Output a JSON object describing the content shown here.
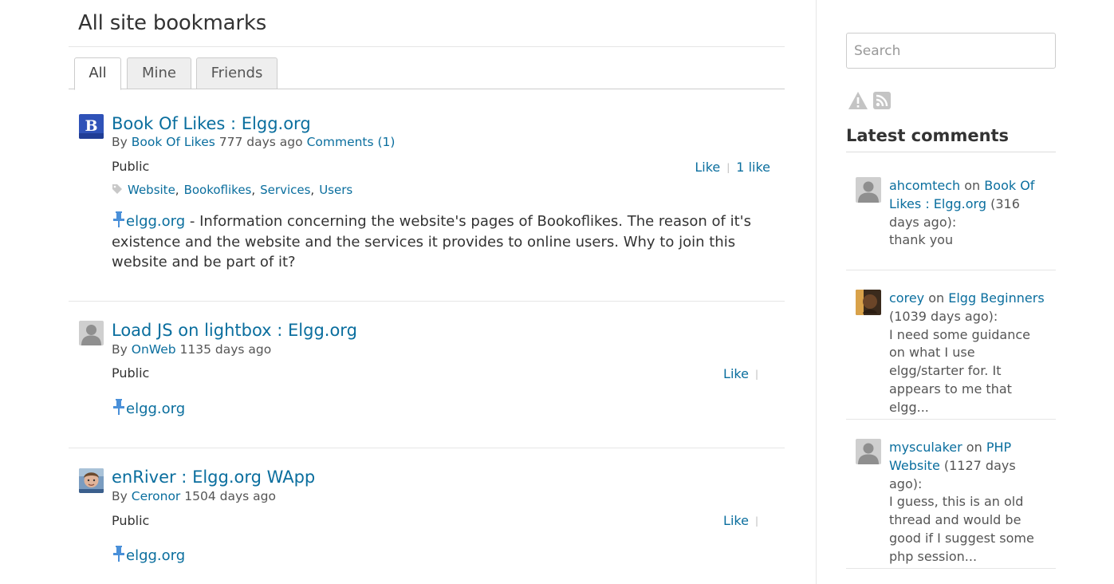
{
  "page": {
    "title": "All site bookmarks"
  },
  "tabs": [
    {
      "label": "All",
      "active": true
    },
    {
      "label": "Mine",
      "active": false
    },
    {
      "label": "Friends",
      "active": false
    }
  ],
  "bookmarks": [
    {
      "title": "Book Of Likes : Elgg.org",
      "by": "By",
      "author": "Book Of Likes",
      "age": "777 days ago",
      "comments_link": "Comments (1)",
      "access": "Public",
      "like_label": "Like",
      "like_count": "1 like",
      "tags": [
        "Website",
        "Bookoflikes",
        "Services",
        "Users"
      ],
      "link": "elgg.org",
      "description": " - Information concerning the website's pages of Bookoflikes. The reason of it's existence and the website and the services it provides to online users. Why to join this website and be part of it?"
    },
    {
      "title": "Load JS on lightbox : Elgg.org",
      "by": "By",
      "author": "OnWeb",
      "age": "1135 days ago",
      "access": "Public",
      "like_label": "Like",
      "link": "elgg.org"
    },
    {
      "title": "enRiver : Elgg.org WApp",
      "by": "By",
      "author": "Ceronor",
      "age": "1504 days ago",
      "access": "Public",
      "like_label": "Like",
      "link": "elgg.org"
    }
  ],
  "sidebar": {
    "search_placeholder": "Search",
    "latest_comments_heading": "Latest comments",
    "comments": [
      {
        "user": "ahcomtech",
        "on": "on",
        "target": "Book Of Likes : Elgg.org",
        "age": "(316 days ago):",
        "text": "thank you"
      },
      {
        "user": "corey",
        "on": "on",
        "target": "Elgg Beginners",
        "age": "(1039 days ago):",
        "text": "I need some guidance on what I use elgg/starter for. It appears to me that elgg..."
      },
      {
        "user": "mysculaker",
        "on": "on",
        "target": "PHP Website",
        "age": "(1127 days ago):",
        "text": "I guess, this is an old thread and would be good if I suggest some php session..."
      }
    ]
  },
  "colors": {
    "link": "#0a6e9e",
    "pin": "#4a90d9",
    "tab_bg": "#eeeeee",
    "text": "#333333"
  },
  "icons": {
    "pin": "pushpin-icon",
    "tag": "tag-icon",
    "report": "warning-icon",
    "rss": "rss-icon"
  }
}
